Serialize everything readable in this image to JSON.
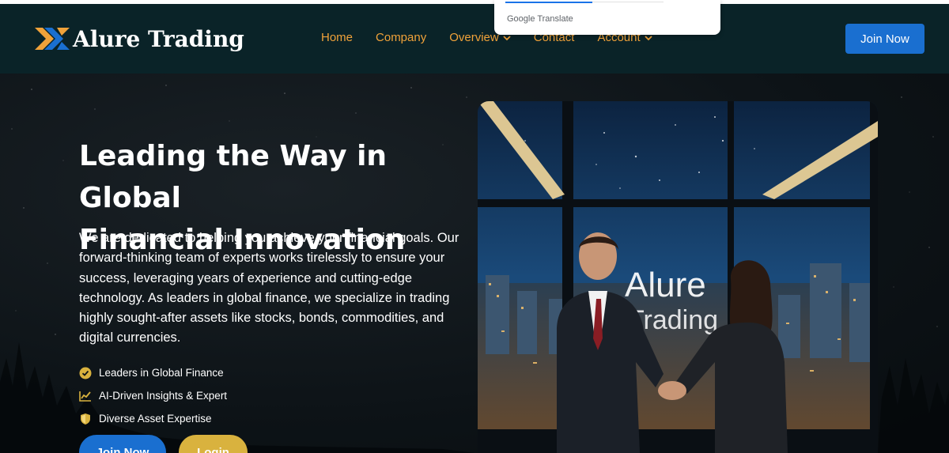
{
  "header": {
    "brand": "Alure Trading",
    "nav": [
      {
        "label": "Home",
        "dropdown": false
      },
      {
        "label": "Company",
        "dropdown": false
      },
      {
        "label": "Overview",
        "dropdown": true
      },
      {
        "label": "Contact",
        "dropdown": false
      },
      {
        "label": "Account",
        "dropdown": true
      }
    ],
    "join_label": "Join Now"
  },
  "translate_popup": {
    "label": "Google Translate"
  },
  "hero": {
    "title_line1": "Leading the Way in Global",
    "title_line2": "Financial Innovation",
    "description": "We are dedicated to helping you achieve your financial goals. Our forward-thinking team of experts works tirelessly to ensure your success, leveraging years of experience and cutting-edge technology. As leaders in global finance, we specialize in trading highly sought-after assets like stocks, bonds, commodities, and digital currencies.",
    "features": [
      {
        "icon": "check-circle-icon",
        "text": "Leaders in Global Finance"
      },
      {
        "icon": "chart-line-icon",
        "text": "AI-Driven Insights & Expert"
      },
      {
        "icon": "shield-icon",
        "text": "Diverse Asset Expertise"
      }
    ],
    "join_label": "Join Now",
    "login_label": "Login",
    "image_sign_line1": "Alure",
    "image_sign_line2": "Trading"
  },
  "colors": {
    "accent_orange": "#f0a23a",
    "primary_blue": "#1a6fd0",
    "gold": "#d9b23e",
    "header_bg": "#0a2328"
  }
}
